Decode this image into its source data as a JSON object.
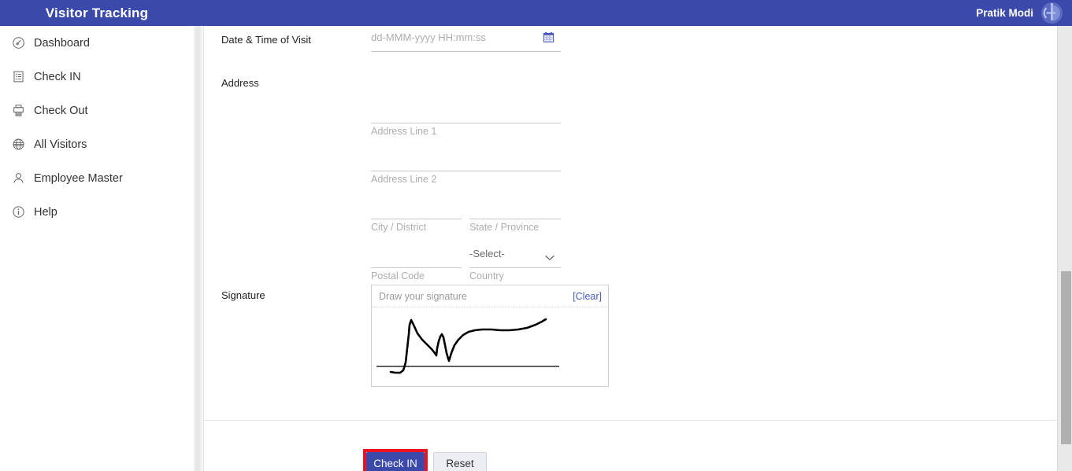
{
  "header": {
    "brand_title": "Visitor Tracking",
    "user_name": "Pratik Modi",
    "avatar_icon": "company-logo-avatar",
    "bg_color": "#3b49ab"
  },
  "sidebar": {
    "items": [
      {
        "label": "Dashboard",
        "icon": "gauge-icon"
      },
      {
        "label": "Check IN",
        "icon": "clipboard-list-icon"
      },
      {
        "label": "Check Out",
        "icon": "printer-icon"
      },
      {
        "label": "All Visitors",
        "icon": "globe-icon"
      },
      {
        "label": "Employee Master",
        "icon": "user-icon"
      },
      {
        "label": "Help",
        "icon": "info-circle-icon"
      }
    ]
  },
  "form": {
    "fields": {
      "datetime": {
        "label": "Date & Time of Visit",
        "placeholder": "dd-MMM-yyyy HH:mm:ss",
        "value": "",
        "icon": "calendar-icon"
      },
      "address": {
        "label": "Address",
        "line1_placeholder": "Address Line 1",
        "line1_value": "",
        "line2_placeholder": "Address Line 2",
        "line2_value": "",
        "city_placeholder": "City / District",
        "city_value": "",
        "state_placeholder": "State / Province",
        "state_value": "",
        "postal_placeholder": "Postal Code",
        "postal_value": "",
        "country_placeholder": "Country",
        "country_selected": "-Select-",
        "country_icon": "chevron-down-icon"
      },
      "signature": {
        "label": "Signature",
        "hint": "Draw your signature",
        "clear_label": "[Clear]",
        "stroke_color": "#000000"
      }
    }
  },
  "footer": {
    "submit_label": "Check IN",
    "reset_label": "Reset",
    "submit_color": "#3b49ab",
    "highlight_color": "#ee1122"
  }
}
